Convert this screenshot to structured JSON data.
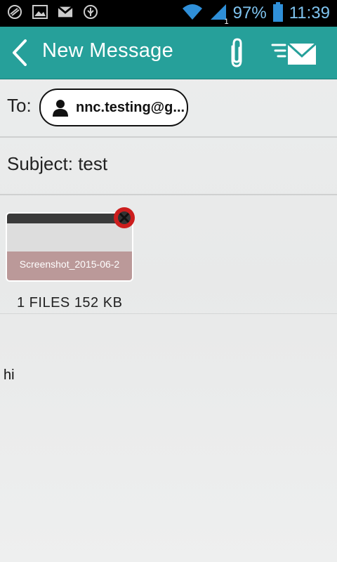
{
  "status_bar": {
    "battery": "97%",
    "time": "11:39",
    "signal_badge": "1",
    "icons": [
      "sync-icon",
      "image-icon",
      "gmail-icon",
      "usb-icon",
      "wifi-icon",
      "signal-icon",
      "battery-icon"
    ]
  },
  "app_bar": {
    "title": "New Message",
    "icons": [
      "back-arrow-icon",
      "paperclip-icon",
      "send-mail-icon"
    ]
  },
  "compose": {
    "to_label": "To:",
    "recipient_chip": "nnc.testing@g...",
    "subject_label": "Subject:",
    "subject_value": "test",
    "attachment": {
      "caption": "Screenshot_2015-06-2",
      "summary": "1  FILES 152  KB"
    },
    "body": "hi"
  },
  "colors": {
    "accent": "#26a09a",
    "status_text": "#7fc4f0",
    "remove_badge": "#cc1d1d"
  }
}
